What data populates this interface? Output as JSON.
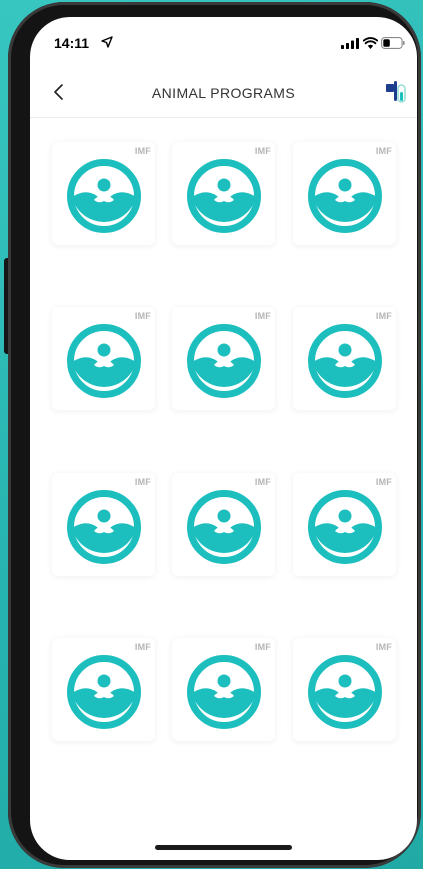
{
  "status_bar": {
    "time": "14:11"
  },
  "nav": {
    "title": "ANIMAL PROGRAMS"
  },
  "colors": {
    "accent": "#1dbfbe",
    "background": "#2bbcb8",
    "tag": "#b5b5b5"
  },
  "programs": [
    {
      "tag": "IMF",
      "icon": "program-logo-icon"
    },
    {
      "tag": "IMF",
      "icon": "program-logo-icon"
    },
    {
      "tag": "IMF",
      "icon": "program-logo-icon"
    },
    {
      "tag": "IMF",
      "icon": "program-logo-icon"
    },
    {
      "tag": "IMF",
      "icon": "program-logo-icon"
    },
    {
      "tag": "IMF",
      "icon": "program-logo-icon"
    },
    {
      "tag": "IMF",
      "icon": "program-logo-icon"
    },
    {
      "tag": "IMF",
      "icon": "program-logo-icon"
    },
    {
      "tag": "IMF",
      "icon": "program-logo-icon"
    },
    {
      "tag": "IMF",
      "icon": "program-logo-icon"
    },
    {
      "tag": "IMF",
      "icon": "program-logo-icon"
    },
    {
      "tag": "IMF",
      "icon": "program-logo-icon"
    }
  ]
}
